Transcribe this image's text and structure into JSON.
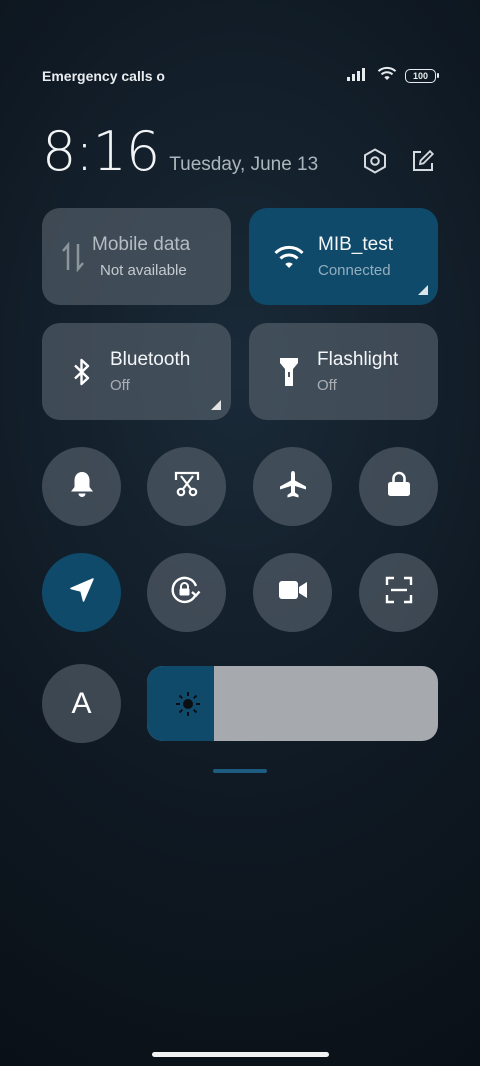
{
  "status_bar": {
    "carrier_text": "Emergency calls o",
    "battery_level": "100",
    "icons": [
      "signal-icon",
      "wifi-icon",
      "battery-icon"
    ]
  },
  "header": {
    "time": "8:16",
    "date": "Tuesday, June 13",
    "icons": [
      "settings-icon",
      "edit-icon"
    ]
  },
  "tiles": {
    "mobile_data": {
      "title": "Mobile data",
      "subtitle": "Not available",
      "active": false,
      "icon": "data-transfer-icon"
    },
    "wifi": {
      "title": "MIB_test",
      "subtitle": "Connected",
      "active": true,
      "icon": "wifi-icon"
    },
    "bluetooth": {
      "title": "Bluetooth",
      "subtitle": "Off",
      "active": false,
      "icon": "bluetooth-icon"
    },
    "flashlight": {
      "title": "Flashlight",
      "subtitle": "Off",
      "active": false,
      "icon": "flashlight-icon"
    }
  },
  "toggles": [
    {
      "name": "silent",
      "icon": "bell-icon",
      "active": false
    },
    {
      "name": "screenshot",
      "icon": "scissors-icon",
      "active": false
    },
    {
      "name": "airplane-mode",
      "icon": "airplane-icon",
      "active": false
    },
    {
      "name": "lock-screen",
      "icon": "lock-icon",
      "active": false
    },
    {
      "name": "location",
      "icon": "location-arrow-icon",
      "active": true
    },
    {
      "name": "rotation-lock",
      "icon": "rotation-lock-icon",
      "active": false
    },
    {
      "name": "screen-recorder",
      "icon": "video-camera-icon",
      "active": false
    },
    {
      "name": "scanner",
      "icon": "scan-icon",
      "active": false
    },
    {
      "name": "auto-brightness",
      "icon": "letter-a-icon",
      "label": "A",
      "active": false
    }
  ],
  "brightness": {
    "level": 0.23,
    "icon": "sun-icon"
  },
  "colors": {
    "accent": "#0f4a6b",
    "tile": "#4b5660",
    "slider_track": "#a6aaae"
  }
}
